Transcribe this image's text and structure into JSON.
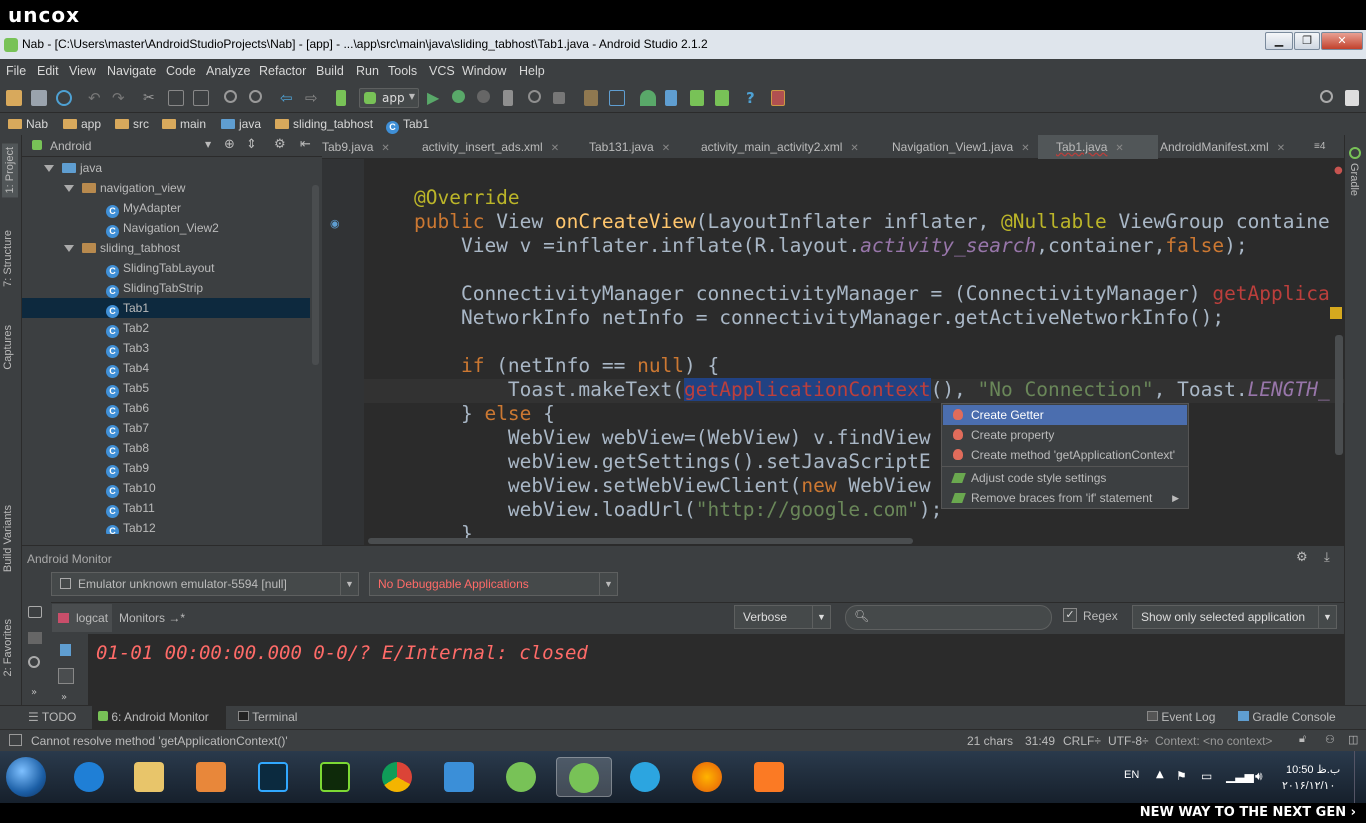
{
  "brand": {
    "top": "uncox",
    "bottom": "NEW WAY TO THE NEXT GEN ›"
  },
  "window": {
    "title": "Nab - [C:\\Users\\master\\AndroidStudioProjects\\Nab] - [app] - ...\\app\\src\\main\\java\\sliding_tabhost\\Tab1.java - Android Studio 2.1.2"
  },
  "menu": [
    "File",
    "Edit",
    "View",
    "Navigate",
    "Code",
    "Analyze",
    "Refactor",
    "Build",
    "Run",
    "Tools",
    "VCS",
    "Window",
    "Help"
  ],
  "toolbar": {
    "run_config": "app"
  },
  "breadcrumb": [
    "Nab",
    "app",
    "src",
    "main",
    "java",
    "sliding_tabhost",
    "Tab1"
  ],
  "left_tabs": {
    "project": "1: Project",
    "structure": "7: Structure",
    "captures": "Captures",
    "build_variants": "Build Variants",
    "favorites": "2: Favorites"
  },
  "right_tabs": {
    "gradle": "Gradle"
  },
  "project": {
    "view": "Android",
    "tree": [
      {
        "label": "java",
        "type": "folder"
      },
      {
        "label": "navigation_view",
        "type": "package"
      },
      {
        "label": "MyAdapter",
        "type": "class"
      },
      {
        "label": "Navigation_View2",
        "type": "class"
      },
      {
        "label": "sliding_tabhost",
        "type": "package"
      },
      {
        "label": "SlidingTabLayout",
        "type": "class"
      },
      {
        "label": "SlidingTabStrip",
        "type": "class"
      },
      {
        "label": "Tab1",
        "type": "class",
        "selected": true
      },
      {
        "label": "Tab2",
        "type": "class"
      },
      {
        "label": "Tab3",
        "type": "class"
      },
      {
        "label": "Tab4",
        "type": "class"
      },
      {
        "label": "Tab5",
        "type": "class"
      },
      {
        "label": "Tab6",
        "type": "class"
      },
      {
        "label": "Tab7",
        "type": "class"
      },
      {
        "label": "Tab8",
        "type": "class"
      },
      {
        "label": "Tab9",
        "type": "class"
      },
      {
        "label": "Tab10",
        "type": "class"
      },
      {
        "label": "Tab11",
        "type": "class"
      },
      {
        "label": "Tab12",
        "type": "class"
      }
    ]
  },
  "editor_tabs": [
    "Tab9.java",
    "activity_insert_ads.xml",
    "Tab131.java",
    "activity_main_activity2.xml",
    "Navigation_View1.java",
    "Tab1.java",
    "AndroidManifest.xml"
  ],
  "editor_tabs_more": "≡4",
  "code": {
    "l1": "@Override",
    "l2a": "public ",
    "l2b": "View ",
    "l2c": "onCreateView",
    "l2d": "(LayoutInflater inflater, ",
    "l2e": "@Nullable",
    "l2f": " ViewGroup containe",
    "l3a": "    View v =inflater.inflate(R.layout.",
    "l3b": "activity_search",
    "l3c": ",container,",
    "l3d": "false",
    "l3e": ");",
    "l4a": "    ConnectivityManager connectivityManager = (ConnectivityManager) ",
    "l4b": "getApplica",
    "l5": "    NetworkInfo netInfo = connectivityManager.getActiveNetworkInfo();",
    "l6a": "    ",
    "l6b": "if",
    "l6c": " (netInfo == ",
    "l6d": "null",
    "l6e": ") {",
    "l7a": "        Toast.makeText(",
    "l7b": "getApplicationContext",
    "l7c": "(), ",
    "l7d": "\"No Connection\"",
    "l7e": ", Toast.",
    "l7f": "LENGTH_",
    "l8a": "    } ",
    "l8b": "else",
    "l8c": " {",
    "l9": "        WebView webView=(WebView) v.findView",
    "l10": "        webView.getSettings().setJavaScriptE",
    "l11a": "        webView.setWebViewClient(",
    "l11b": "new",
    "l11c": " WebView",
    "l12a": "        webView.loadUrl(",
    "l12b": "\"http://google.com\"",
    "l12c": ");",
    "l13": "    }"
  },
  "popup": {
    "items": [
      "Create Getter",
      "Create property",
      "Create method 'getApplicationContext'",
      "Adjust code style settings",
      "Remove braces from 'if' statement"
    ]
  },
  "monitor": {
    "title": "Android Monitor",
    "device": "Emulator unknown emulator-5594 [null]",
    "app": "No Debuggable Applications",
    "tab_logcat": "logcat",
    "tab_monitors": "Monitors",
    "tab_monitors_arrow": "→*",
    "level": "Verbose",
    "search_placeholder": "",
    "regex": "Regex",
    "filter": "Show only selected application",
    "log": "01-01 00:00:00.000 0-0/? E/Internal: closed"
  },
  "bottom_tabs": {
    "todo": "TODO",
    "android_monitor": "6: Android Monitor",
    "terminal": "Terminal",
    "event_log": "Event Log",
    "gradle_console": "Gradle Console"
  },
  "status": {
    "message": "Cannot resolve method 'getApplicationContext()'",
    "chars": "21 chars",
    "pos": "31:49",
    "crlf": "CRLF÷",
    "enc": "UTF-8÷",
    "context": "Context: <no context>"
  },
  "taskbar": {
    "lang": "EN",
    "time": "10:50 ب.ظ",
    "date": "۲۰۱۶/۱۲/۱۰"
  },
  "colors": {
    "accent": "#4b6eaf",
    "error": "#bc3f3c",
    "keyword": "#cc7832"
  }
}
